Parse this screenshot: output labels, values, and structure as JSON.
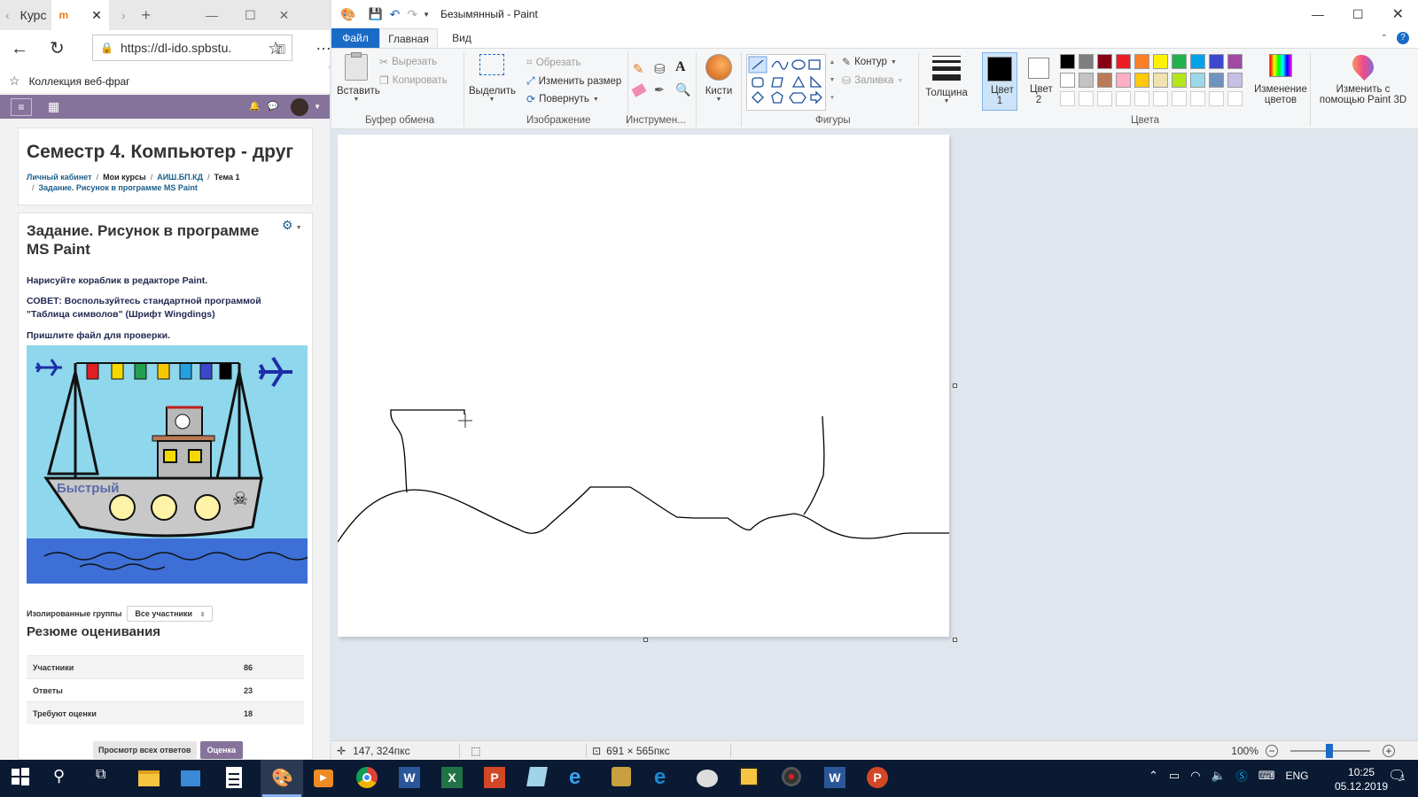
{
  "browser": {
    "tabs": [
      {
        "label": "Курс",
        "active": false
      },
      {
        "label": "m",
        "active": true
      }
    ],
    "url": "https://dl-ido.spbstu.",
    "favorites": {
      "item": "Коллекция веб-фраг"
    }
  },
  "moodle": {
    "page_title": "Семестр 4. Компьютер - друг",
    "breadcrumb": [
      "Личный кабинет",
      "Мои курсы",
      "АИШ.БП.КД",
      "Тема 1",
      "Задание. Рисунок в программе MS Paint"
    ],
    "task_title": "Задание. Рисунок в программе MS Paint",
    "task_text_1": "Нарисуйте кораблик в редакторе Paint.",
    "task_text_2": "СОВЕТ: Воспользуйтесь стандартной программой \"Таблица символов\" (Шрифт Wingdings)",
    "task_text_3": "Пришлите файл для проверки.",
    "ship_label": "Быстрый",
    "groups_label": "Изолированные группы",
    "groups_select": "Все участники",
    "grading_title": "Резюме оценивания",
    "grading_rows": [
      {
        "label": "Участники",
        "value": "86"
      },
      {
        "label": "Ответы",
        "value": "23"
      },
      {
        "label": "Требуют оценки",
        "value": "18"
      }
    ],
    "btn_view_all": "Просмотр всех ответов",
    "btn_grade": "Оценка"
  },
  "paint": {
    "window_title": "Безымянный - Paint",
    "menu_tabs": [
      "Файл",
      "Главная",
      "Вид"
    ],
    "clipboard": {
      "paste": "Вставить",
      "cut": "Вырезать",
      "copy": "Копировать",
      "group": "Буфер обмена"
    },
    "image": {
      "select": "Выделить",
      "crop": "Обрезать",
      "resize": "Изменить размер",
      "rotate": "Повернуть",
      "group": "Изображение"
    },
    "tools": {
      "group": "Инструмен..."
    },
    "brushes": {
      "label": "Кисти"
    },
    "shapes": {
      "outline": "Контур",
      "fill": "Заливка",
      "group": "Фигуры"
    },
    "size": {
      "label": "Толщина"
    },
    "colors": {
      "color1": "Цвет 1",
      "color2": "Цвет 2",
      "edit": "Изменение цветов",
      "group": "Цвета",
      "palette_row1": [
        "#000000",
        "#7f7f7f",
        "#880015",
        "#ed1c24",
        "#ff7f27",
        "#fff200",
        "#22b14c",
        "#00a2e8",
        "#3f48cc",
        "#a349a4"
      ],
      "palette_row2": [
        "#ffffff",
        "#c3c3c3",
        "#b97a57",
        "#ffaec9",
        "#ffc90e",
        "#efe4b0",
        "#b5e61d",
        "#99d9ea",
        "#7092be",
        "#c8bfe7"
      ]
    },
    "paint3d": "Изменить с помощью Paint 3D",
    "status": {
      "cursor": "147, 324пкс",
      "size": "691 × 565пкс",
      "zoom": "100%"
    }
  },
  "taskbar": {
    "lang": "ENG",
    "time": "10:25",
    "date": "05.12.2019",
    "notifications": "1"
  }
}
